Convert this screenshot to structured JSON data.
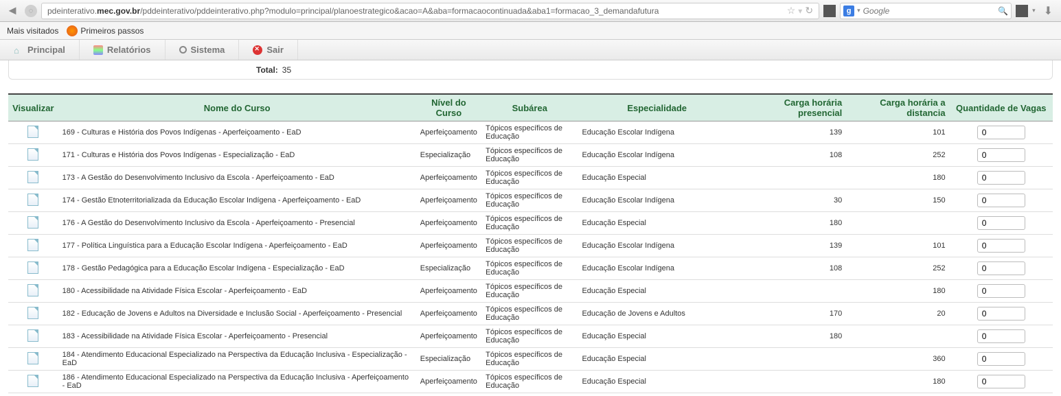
{
  "browser": {
    "url_prefix": "pdeinterativo.",
    "url_bold": "mec.gov.br",
    "url_suffix": "/pddeinterativo/pddeinterativo.php?modulo=principal/planoestrategico&acao=A&aba=formacaocontinuada&aba1=formacao_3_demandafutura",
    "search_engine": "g",
    "search_placeholder": "Google"
  },
  "bookmarks": {
    "most_visited": "Mais visitados",
    "first_steps": "Primeiros passos"
  },
  "menu": {
    "principal": "Principal",
    "relatorios": "Relatórios",
    "sistema": "Sistema",
    "sair": "Sair"
  },
  "table": {
    "total_label": "Total:",
    "total_value": "35",
    "headers": {
      "visualizar": "Visualizar",
      "nome": "Nome do Curso",
      "nivel": "Nível do Curso",
      "subarea": "Subárea",
      "especialidade": "Especialidade",
      "carga_presencial": "Carga horária presencial",
      "carga_distancia": "Carga horária a distancia",
      "quantidade": "Quantidade de Vagas"
    },
    "rows": [
      {
        "nome": "169 - Culturas e História dos Povos Indígenas - Aperfeiçoamento - EaD",
        "nivel": "Aperfeiçoamento",
        "sub": "Tópicos específicos de Educação",
        "esp": "Educação Escolar Indígena",
        "cp": "139",
        "cd": "101",
        "qv": "0"
      },
      {
        "nome": "171 - Culturas e História dos Povos Indígenas - Especialização - EaD",
        "nivel": "Especialização",
        "sub": "Tópicos específicos de Educação",
        "esp": "Educação Escolar Indígena",
        "cp": "108",
        "cd": "252",
        "qv": "0"
      },
      {
        "nome": "173 - A Gestão do Desenvolvimento Inclusivo da Escola - Aperfeiçoamento - EaD",
        "nivel": "Aperfeiçoamento",
        "sub": "Tópicos específicos de Educação",
        "esp": "Educação Especial",
        "cp": "",
        "cd": "180",
        "qv": "0"
      },
      {
        "nome": "174 - Gestão Etnoterritorializada da Educação Escolar Indígena - Aperfeiçoamento - EaD",
        "nivel": "Aperfeiçoamento",
        "sub": "Tópicos específicos de Educação",
        "esp": "Educação Escolar Indígena",
        "cp": "30",
        "cd": "150",
        "qv": "0"
      },
      {
        "nome": "176 - A Gestão do Desenvolvimento Inclusivo da Escola - Aperfeiçoamento - Presencial",
        "nivel": "Aperfeiçoamento",
        "sub": "Tópicos específicos de Educação",
        "esp": "Educação Especial",
        "cp": "180",
        "cd": "",
        "qv": "0"
      },
      {
        "nome": "177 - Política Linguística para a Educação Escolar Indígena - Aperfeiçoamento - EaD",
        "nivel": "Aperfeiçoamento",
        "sub": "Tópicos específicos de Educação",
        "esp": "Educação Escolar Indígena",
        "cp": "139",
        "cd": "101",
        "qv": "0"
      },
      {
        "nome": "178 - Gestão Pedagógica para a Educação Escolar Indígena - Especialização - EaD",
        "nivel": "Especialização",
        "sub": "Tópicos específicos de Educação",
        "esp": "Educação Escolar Indígena",
        "cp": "108",
        "cd": "252",
        "qv": "0"
      },
      {
        "nome": "180 - Acessibilidade na Atividade Física Escolar - Aperfeiçoamento - EaD",
        "nivel": "Aperfeiçoamento",
        "sub": "Tópicos específicos de Educação",
        "esp": "Educação Especial",
        "cp": "",
        "cd": "180",
        "qv": "0"
      },
      {
        "nome": "182 - Educação de Jovens e Adultos na Diversidade e Inclusão Social - Aperfeiçoamento - Presencial",
        "nivel": "Aperfeiçoamento",
        "sub": "Tópicos específicos de Educação",
        "esp": "Educação de Jovens e Adultos",
        "cp": "170",
        "cd": "20",
        "qv": "0"
      },
      {
        "nome": "183 - Acessibilidade na Atividade Física Escolar - Aperfeiçoamento - Presencial",
        "nivel": "Aperfeiçoamento",
        "sub": "Tópicos específicos de Educação",
        "esp": "Educação Especial",
        "cp": "180",
        "cd": "",
        "qv": "0"
      },
      {
        "nome": "184 - Atendimento Educacional Especializado na Perspectiva da Educação Inclusiva - Especialização - EaD",
        "nivel": "Especialização",
        "sub": "Tópicos específicos de Educação",
        "esp": "Educação Especial",
        "cp": "",
        "cd": "360",
        "qv": "0"
      },
      {
        "nome": "186 - Atendimento Educacional Especializado na Perspectiva da Educação Inclusiva - Aperfeiçoamento - EaD",
        "nivel": "Aperfeiçoamento",
        "sub": "Tópicos específicos de Educação",
        "esp": "Educação Especial",
        "cp": "",
        "cd": "180",
        "qv": "0"
      }
    ]
  }
}
